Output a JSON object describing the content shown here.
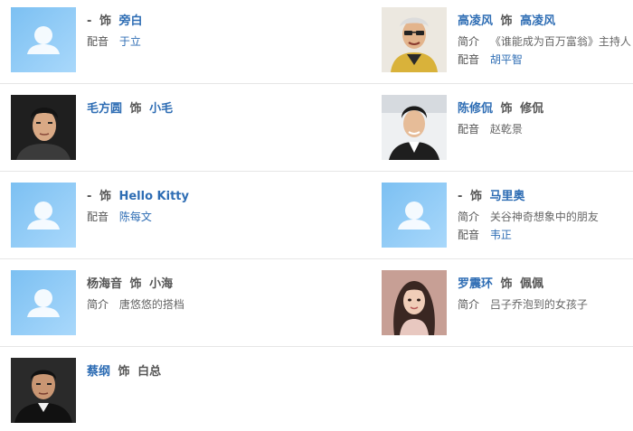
{
  "cast": [
    {
      "left": {
        "actor": "-",
        "separator": "饰",
        "role": "旁白",
        "lines": [
          {
            "label": "配音",
            "value": "于立"
          }
        ]
      },
      "right": {
        "actor": "高凌风",
        "separator": "饰",
        "role": "高凌风",
        "lines": [
          {
            "label": "简介",
            "value": "《谁能成为百万富翁》主持人"
          },
          {
            "label": "配音",
            "value": "胡平智"
          }
        ]
      }
    },
    {
      "left": {
        "actor": "毛方圆",
        "separator": "饰",
        "role": "小毛",
        "lines": []
      },
      "right": {
        "actor": "陈修侃",
        "separator": "饰",
        "role": "修侃",
        "lines": [
          {
            "label": "配音",
            "value": "赵乾景"
          }
        ]
      }
    },
    {
      "left": {
        "actor": "-",
        "separator": "饰",
        "role": "Hello Kitty",
        "lines": [
          {
            "label": "配音",
            "value": "陈每文"
          }
        ]
      },
      "right": {
        "actor": "-",
        "separator": "饰",
        "role": "马里奥",
        "lines": [
          {
            "label": "简介",
            "value": "关谷神奇想象中的朋友"
          },
          {
            "label": "配音",
            "value": "韦正"
          }
        ]
      }
    },
    {
      "left": {
        "actor": "杨海音",
        "separator": "饰",
        "role": "小海",
        "lines": [
          {
            "label": "简介",
            "value": "唐悠悠的搭档"
          }
        ]
      },
      "right": {
        "actor": "罗震环",
        "separator": "饰",
        "role": "佩佩",
        "lines": [
          {
            "label": "简介",
            "value": "吕子乔泡到的女孩子"
          }
        ]
      }
    },
    {
      "left": {
        "actor": "蔡纲",
        "separator": "饰",
        "role": "白总",
        "lines": []
      }
    }
  ]
}
